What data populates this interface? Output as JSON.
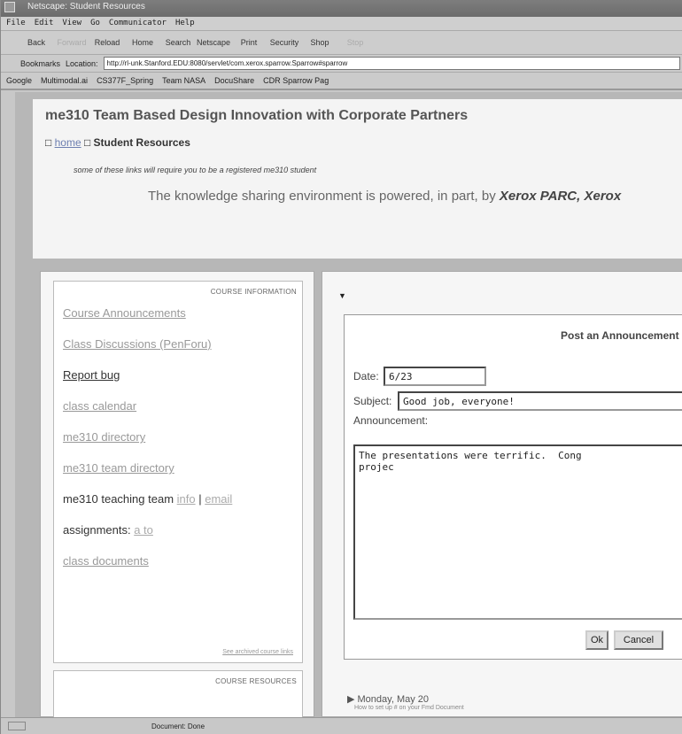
{
  "window": {
    "title": "Netscape: Student Resources"
  },
  "menu": [
    "File",
    "Edit",
    "View",
    "Go",
    "Communicator",
    "Help"
  ],
  "toolbar": [
    "Back",
    "Forward",
    "Reload",
    "Home",
    "Search",
    "Netscape",
    "Print",
    "Security",
    "Shop",
    "Stop"
  ],
  "location": {
    "bookmarks": "Bookmarks",
    "label": "Location:",
    "url": "http://rl-unk.Stanford.EDU:8080/servlet/com.xerox.sparrow.Sparrow#sparrow"
  },
  "personal": [
    "Google",
    "Multimodal.ai",
    "CS377F_Spring",
    "Team NASA",
    "DocuShare",
    "CDR Sparrow Pag"
  ],
  "header": {
    "title": "me310 Team Based Design Innovation with Corporate Partners",
    "crumb_home": "home",
    "crumb_current": "Student Resources",
    "note": "some of these links will require you to be a registered me310 student",
    "powered_text": "The knowledge sharing environment is powered, in part, by",
    "powered_by": "Xerox PARC, Xerox"
  },
  "left": {
    "section": "COURSE INFORMATION",
    "links": [
      {
        "label": "Course Announcements"
      },
      {
        "label": "Class Discussions (PenForu)"
      },
      {
        "label": "Report bug"
      },
      {
        "label": "class calendar"
      },
      {
        "label": "me310 directory"
      },
      {
        "label": "me310 team directory"
      }
    ],
    "team_label": "me310 teaching team",
    "team_info": "info",
    "team_email": "email",
    "assign_label": "assignments:",
    "assign_link": "a to",
    "docs": "class documents",
    "archived": "See archived course links",
    "section2": "COURSE RESOURCES"
  },
  "dialog": {
    "title": "Post an Announcement",
    "date_label": "Date:",
    "date_value": "6/23",
    "subject_label": "Subject:",
    "subject_value": "Good job, everyone!",
    "body_label": "Announcement:",
    "body_value": "The presentations were terrific.  Cong\nprojec",
    "ok": "Ok",
    "cancel": "Cancel"
  },
  "event": {
    "day": "Monday, May 20",
    "sub": "How to set up # on your Fmd Document"
  },
  "status": {
    "text": "Document: Done"
  }
}
